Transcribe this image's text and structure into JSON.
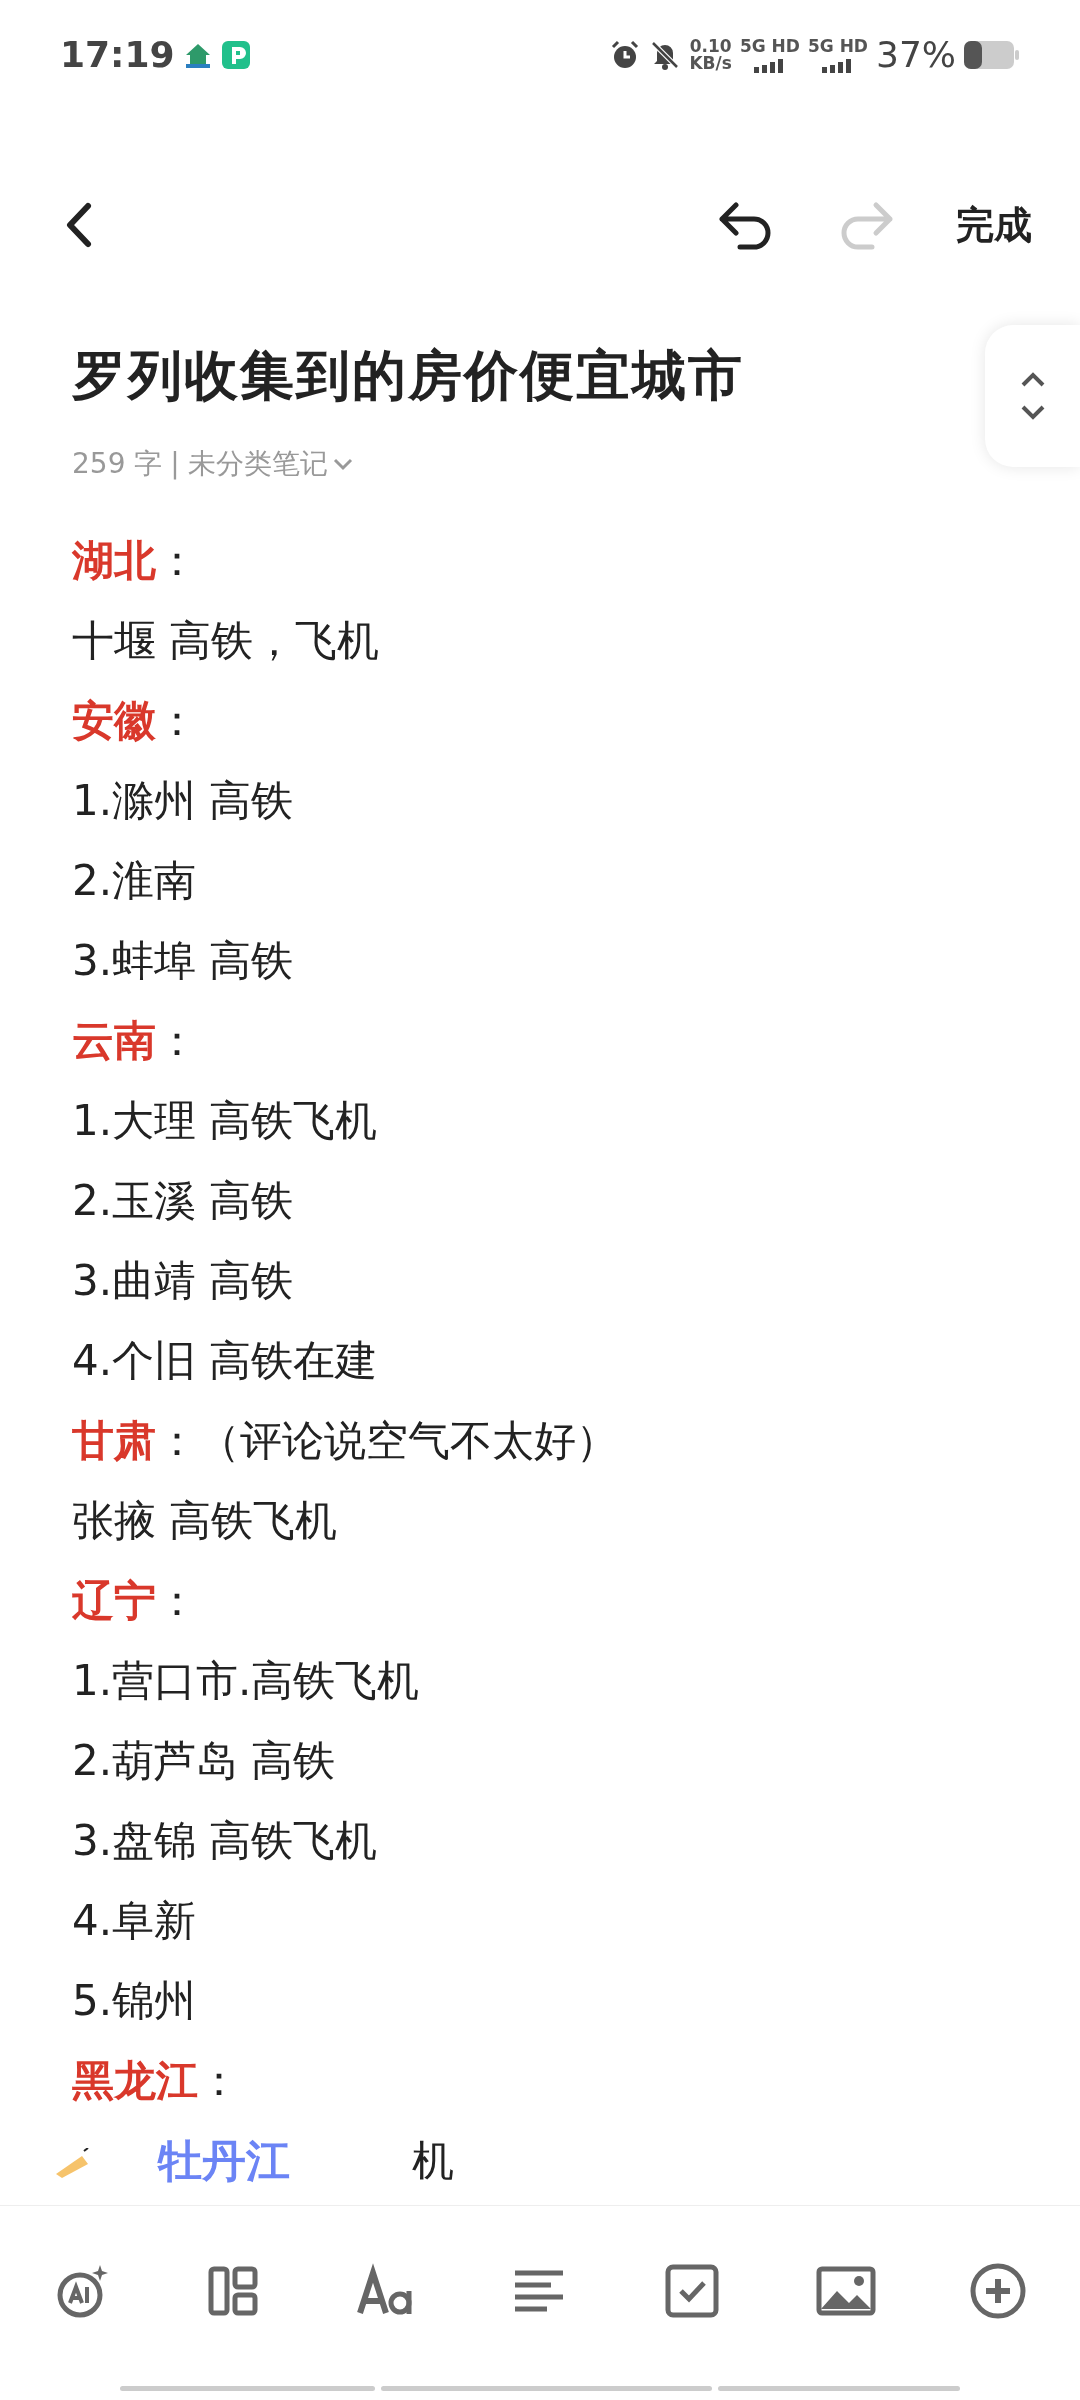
{
  "status_bar": {
    "time": "17:19",
    "net_speed": "0.10",
    "net_unit": "KB/s",
    "networks": [
      "5G HD",
      "5G HD"
    ],
    "battery": "37%"
  },
  "header": {
    "done": "完成"
  },
  "note": {
    "title": "罗列收集到的房价便宜城市",
    "word_count": "259 字",
    "separator": "|",
    "category": "未分类笔记",
    "lines": [
      {
        "kind": "heading",
        "label": "湖北",
        "suffix": "："
      },
      {
        "kind": "text",
        "text": "十堰 高铁，飞机"
      },
      {
        "kind": "heading",
        "label": "安徽",
        "suffix": "："
      },
      {
        "kind": "text",
        "text": "1.滁州 高铁"
      },
      {
        "kind": "text",
        "text": "2.淮南"
      },
      {
        "kind": "text",
        "text": "3.蚌埠 高铁"
      },
      {
        "kind": "heading",
        "label": "云南",
        "suffix": "："
      },
      {
        "kind": "text",
        "text": "1.大理 高铁飞机"
      },
      {
        "kind": "text",
        "text": "2.玉溪 高铁"
      },
      {
        "kind": "text",
        "text": "3.曲靖 高铁"
      },
      {
        "kind": "text",
        "text": "4.个旧 高铁在建"
      },
      {
        "kind": "heading",
        "label": "甘肃",
        "suffix": "：（评论说空气不太好）"
      },
      {
        "kind": "text",
        "text": "张掖 高铁飞机"
      },
      {
        "kind": "heading",
        "label": "辽宁",
        "suffix": "："
      },
      {
        "kind": "text",
        "text": "1.营口市.高铁飞机"
      },
      {
        "kind": "text",
        "text": "2.葫芦岛 高铁"
      },
      {
        "kind": "text",
        "text": "3.盘锦 高铁飞机"
      },
      {
        "kind": "text",
        "text": "4.阜新"
      },
      {
        "kind": "text",
        "text": "5.锦州"
      },
      {
        "kind": "heading",
        "label": "黑龙江",
        "suffix": "："
      },
      {
        "kind": "covered",
        "overlay": "牡丹江",
        "text": "机"
      }
    ]
  }
}
